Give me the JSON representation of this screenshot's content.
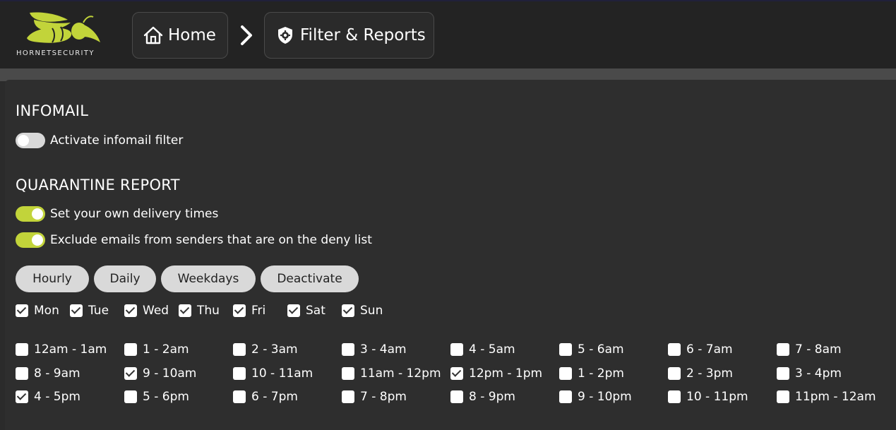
{
  "header": {
    "logo_text": "HORNETSECURITY",
    "breadcrumb": [
      {
        "label": "Home",
        "icon": "home-icon"
      },
      {
        "label": "Filter & Reports",
        "icon": "shield-gear-icon"
      }
    ],
    "colors": {
      "bar": "#232323",
      "accent": "#c2d43a"
    }
  },
  "infomail": {
    "title": "INFOMAIL",
    "toggles": [
      {
        "label": "Activate infomail filter",
        "on": false
      }
    ]
  },
  "quarantine": {
    "title": "QUARANTINE REPORT",
    "toggles": [
      {
        "label": "Set your own delivery times",
        "on": true
      },
      {
        "label": "Exclude emails from senders that are on the deny list",
        "on": true
      }
    ],
    "presets": [
      "Hourly",
      "Daily",
      "Weekdays",
      "Deactivate"
    ],
    "days": [
      {
        "label": "Mon",
        "checked": true
      },
      {
        "label": "Tue",
        "checked": true
      },
      {
        "label": "Wed",
        "checked": true
      },
      {
        "label": "Thu",
        "checked": true
      },
      {
        "label": "Fri",
        "checked": true
      },
      {
        "label": "Sat",
        "checked": true
      },
      {
        "label": "Sun",
        "checked": true
      }
    ],
    "times": [
      {
        "label": "12am - 1am",
        "checked": false
      },
      {
        "label": "1 - 2am",
        "checked": false
      },
      {
        "label": "2 - 3am",
        "checked": false
      },
      {
        "label": "3 - 4am",
        "checked": false
      },
      {
        "label": "4 - 5am",
        "checked": false
      },
      {
        "label": "5 - 6am",
        "checked": false
      },
      {
        "label": "6 - 7am",
        "checked": false
      },
      {
        "label": "7 - 8am",
        "checked": false
      },
      {
        "label": "8 - 9am",
        "checked": false
      },
      {
        "label": "9 - 10am",
        "checked": true
      },
      {
        "label": "10 - 11am",
        "checked": false
      },
      {
        "label": "11am - 12pm",
        "checked": false
      },
      {
        "label": "12pm - 1pm",
        "checked": true
      },
      {
        "label": "1 - 2pm",
        "checked": false
      },
      {
        "label": "2 - 3pm",
        "checked": false
      },
      {
        "label": "3 - 4pm",
        "checked": false
      },
      {
        "label": "4 - 5pm",
        "checked": true
      },
      {
        "label": "5 - 6pm",
        "checked": false
      },
      {
        "label": "6 - 7pm",
        "checked": false
      },
      {
        "label": "7 - 8pm",
        "checked": false
      },
      {
        "label": "8 - 9pm",
        "checked": false
      },
      {
        "label": "9 - 10pm",
        "checked": false
      },
      {
        "label": "10 - 11pm",
        "checked": false
      },
      {
        "label": "11pm - 12am",
        "checked": false
      }
    ]
  }
}
